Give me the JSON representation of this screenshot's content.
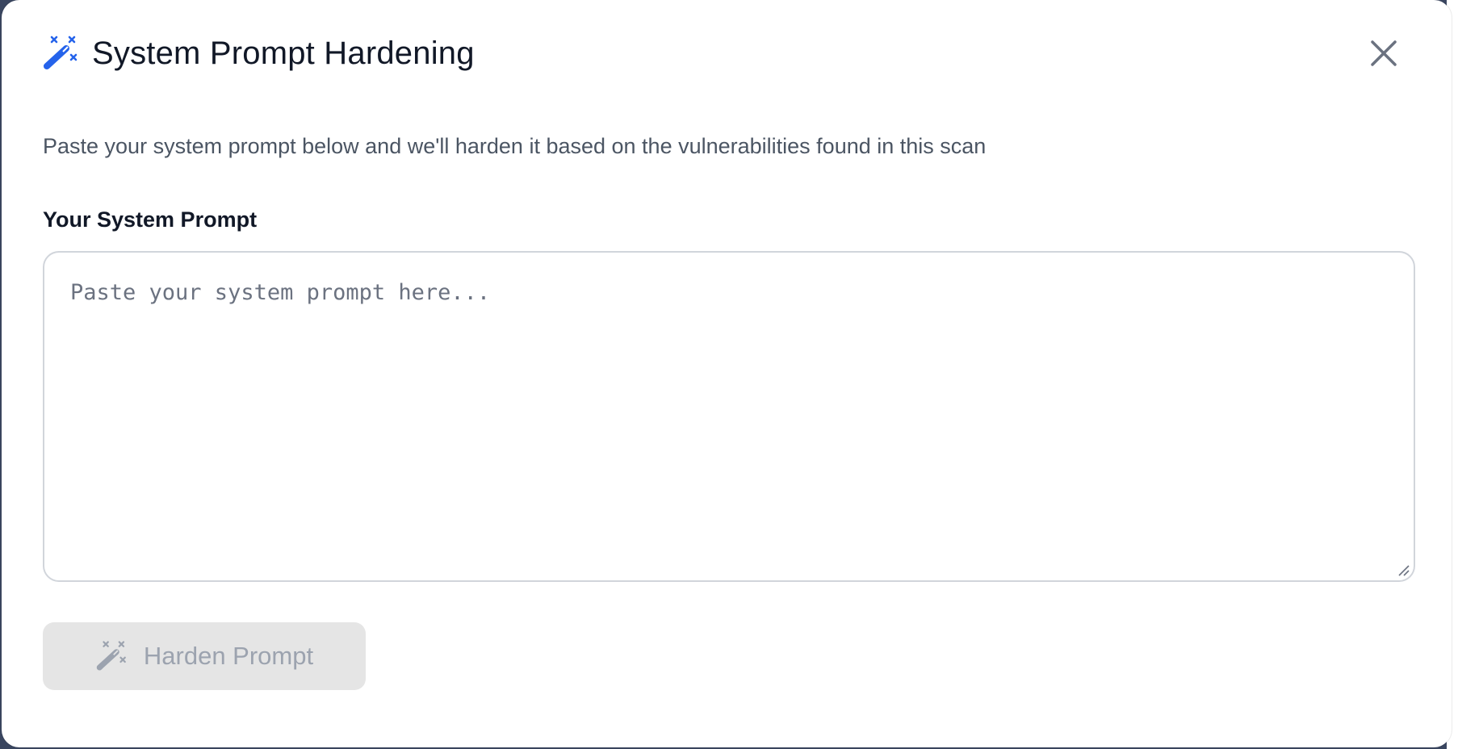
{
  "modal": {
    "title": "System Prompt Hardening",
    "title_icon": "magic-wand-icon",
    "close_icon": "close-icon",
    "description": "Paste your system prompt below and we'll harden it based on the vulnerabilities found in this scan",
    "prompt_label": "Your System Prompt",
    "prompt_value": "",
    "prompt_placeholder": "Paste your system prompt here...",
    "submit": {
      "label": "Harden Prompt",
      "icon": "magic-wand-icon",
      "disabled": true
    }
  },
  "colors": {
    "accent": "#2563eb",
    "title_text": "#111827",
    "muted_text": "#4b5563",
    "button_disabled_bg": "#e5e5e5",
    "button_disabled_text": "#9ca3af"
  }
}
